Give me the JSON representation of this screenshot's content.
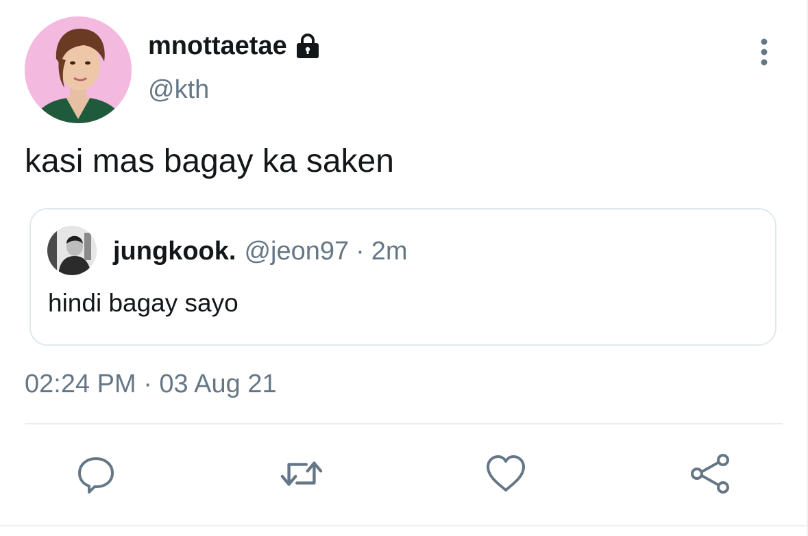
{
  "tweet": {
    "author": {
      "display_name": "mnottaetae",
      "handle": "@kth",
      "protected_icon": "lock-icon",
      "avatar": "avatar"
    },
    "text": "kasi mas bagay ka saken",
    "quoted": {
      "display_name": "jungkook.",
      "handle": "@jeon97",
      "separator": "·",
      "time": "2m",
      "text": "hindi bagay sayo"
    },
    "timestamp": "02:24 PM · 03 Aug 21"
  },
  "actions": [
    {
      "name": "reply",
      "icon": "reply-icon"
    },
    {
      "name": "retweet",
      "icon": "retweet-icon"
    },
    {
      "name": "like",
      "icon": "heart-icon"
    },
    {
      "name": "share",
      "icon": "share-icon"
    }
  ],
  "more_icon": "more-vertical-icon",
  "colors": {
    "text_primary": "#14171a",
    "text_secondary": "#657786",
    "border": "#e1e8ed",
    "avatar_bg": "#f2b6dc"
  }
}
